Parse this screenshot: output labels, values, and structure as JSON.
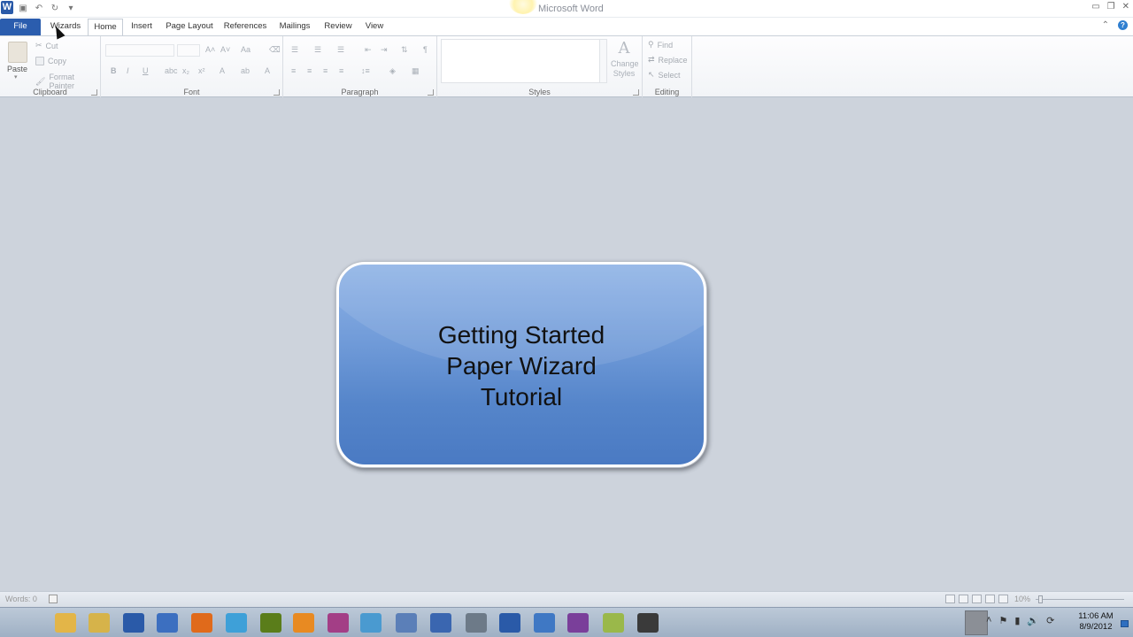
{
  "window": {
    "title": "Microsoft Word",
    "app_icon_letter": "W",
    "qat": [
      "save-icon",
      "undo-icon",
      "redo-icon",
      "customize-qat-icon"
    ],
    "controls": [
      "minimize",
      "restore",
      "close"
    ]
  },
  "tabs": [
    {
      "label": "File"
    },
    {
      "label": "Wizards"
    },
    {
      "label": "Home"
    },
    {
      "label": "Insert"
    },
    {
      "label": "Page Layout"
    },
    {
      "label": "References"
    },
    {
      "label": "Mailings"
    },
    {
      "label": "Review"
    },
    {
      "label": "View"
    }
  ],
  "ribbon": {
    "clipboard": {
      "label": "Clipboard",
      "paste": "Paste",
      "cut": "Cut",
      "copy": "Copy",
      "format_painter": "Format Painter"
    },
    "font": {
      "label": "Font"
    },
    "paragraph": {
      "label": "Paragraph"
    },
    "styles": {
      "label": "Styles",
      "change_styles_line1": "Change",
      "change_styles_line2": "Styles"
    },
    "editing": {
      "label": "Editing",
      "find": "Find",
      "replace": "Replace",
      "select": "Select"
    }
  },
  "document": {
    "callout": {
      "line1": "Getting Started",
      "line2": "Paper Wizard",
      "line3": "Tutorial"
    }
  },
  "status": {
    "words": "Words: 0",
    "zoom": "10%"
  },
  "taskbar": {
    "clock_time": "11:06 AM",
    "clock_date": "8/9/2012",
    "apps": [
      {
        "icon": "explorer-folder-icon",
        "color": "#e3b548"
      },
      {
        "icon": "files-icon",
        "color": "#d6b34a"
      },
      {
        "icon": "word-icon",
        "color": "#2a5aa8"
      },
      {
        "icon": "word-doc-icon",
        "color": "#3c6fc0"
      },
      {
        "icon": "firefox-icon",
        "color": "#e06a1b"
      },
      {
        "icon": "ie-icon",
        "color": "#3ea0d8"
      },
      {
        "icon": "dreamweaver-icon",
        "color": "#5a7d1a"
      },
      {
        "icon": "media-player-icon",
        "color": "#e88a22"
      },
      {
        "icon": "onenote-icon",
        "color": "#a33e86"
      },
      {
        "icon": "app-icon",
        "color": "#4a9ad0"
      },
      {
        "icon": "document-icon",
        "color": "#5b7fb8"
      },
      {
        "icon": "word-2-icon",
        "color": "#3a66b0"
      },
      {
        "icon": "disk-icon",
        "color": "#6d7a88"
      },
      {
        "icon": "word-active-icon",
        "color": "#2a5aa8"
      },
      {
        "icon": "feather-icon",
        "color": "#3f78c4"
      },
      {
        "icon": "hat-icon",
        "color": "#7a3f9a"
      },
      {
        "icon": "notes-icon",
        "color": "#9ab84a"
      },
      {
        "icon": "printer-icon",
        "color": "#3a3a3a"
      }
    ]
  }
}
